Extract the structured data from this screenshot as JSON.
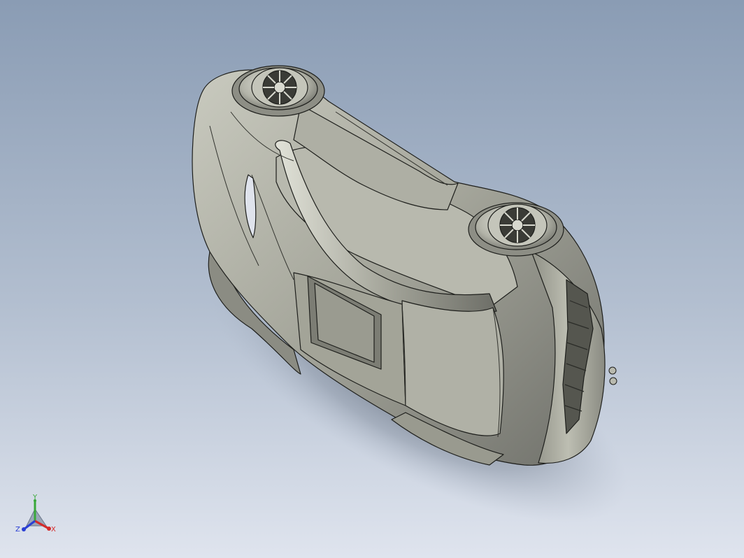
{
  "viewport": {
    "background_top": "#8a9cb4",
    "background_bottom": "#dfe4ee",
    "model_fill": "#a9aa9f",
    "model_edge": "#1e1f1c",
    "shadow": "#6e7886"
  },
  "triad": {
    "y_label": "Y",
    "x_label": "X",
    "z_label": "Z",
    "y_color": "#39a83a",
    "x_color": "#d42a2a",
    "z_color": "#2a3fd4"
  }
}
